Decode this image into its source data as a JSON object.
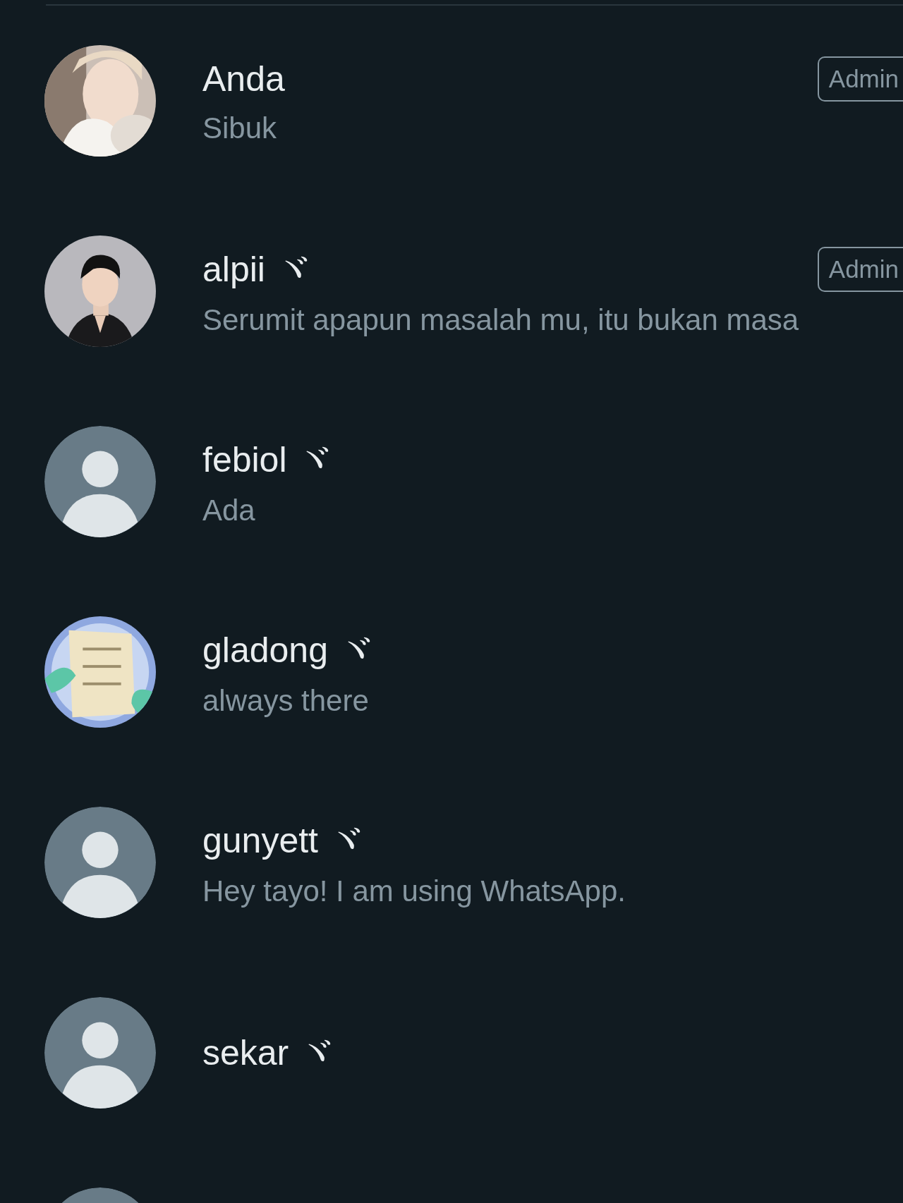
{
  "members": [
    {
      "name": "Anda",
      "status": "Sibuk",
      "badge": "Admin"
    },
    {
      "name": "alpii ヾ",
      "status": "Serumit apapun masalah mu, itu bukan masa",
      "badge": "Admin"
    },
    {
      "name": "febiol ヾ",
      "status": "Ada",
      "kind": "placeholder"
    },
    {
      "name": "gladong ヾ",
      "status": "always there"
    },
    {
      "name": "gunyett ヾ",
      "status": "Hey tayo! I am using WhatsApp.",
      "kind": "placeholder"
    },
    {
      "name": "sekar ヾ",
      "kind": "placeholder"
    },
    {
      "kind": "placeholder"
    }
  ]
}
